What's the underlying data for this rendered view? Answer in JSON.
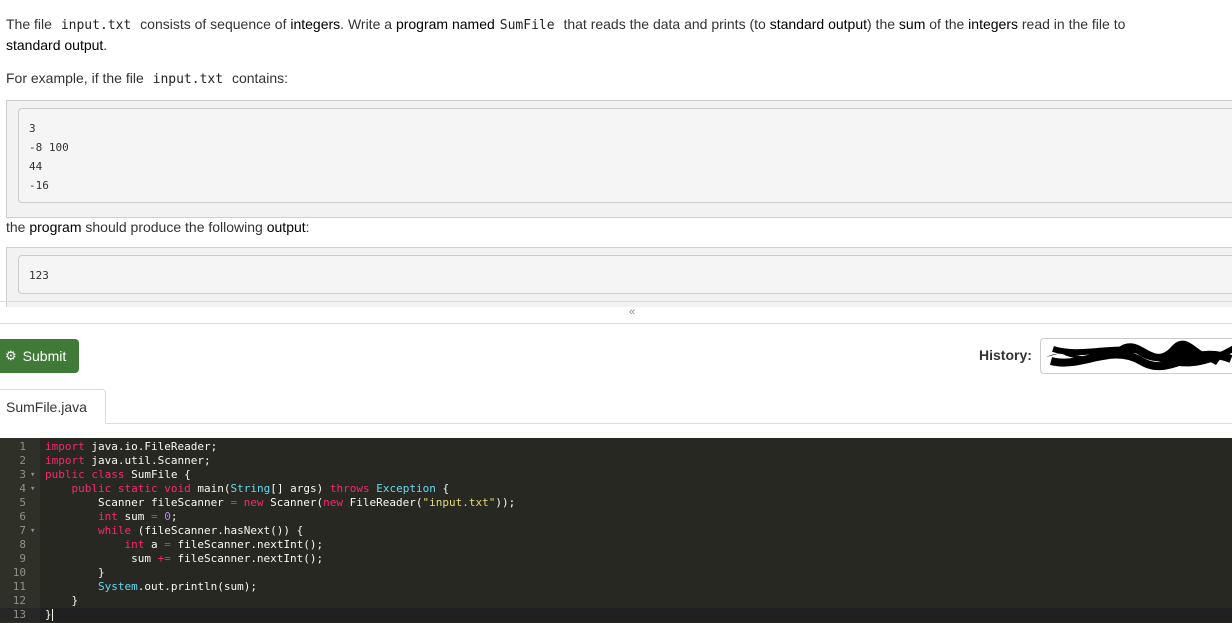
{
  "problem": {
    "p1": [
      {
        "t": "The file ",
        "code": false,
        "bold": false
      },
      {
        "t": "input.txt",
        "code": true,
        "bold": false
      },
      {
        "t": " consists of sequence of ",
        "code": false,
        "bold": false
      },
      {
        "t": "integers",
        "code": false,
        "bold": true
      },
      {
        "t": ". Write a ",
        "code": false,
        "bold": false
      },
      {
        "t": "program named",
        "code": false,
        "bold": true
      },
      {
        "t": "SumFile",
        "code": true,
        "bold": false
      },
      {
        "t": " that reads the data and prints (to ",
        "code": false,
        "bold": false
      },
      {
        "t": "standard output",
        "code": false,
        "bold": true
      },
      {
        "t": ") the ",
        "code": false,
        "bold": false
      },
      {
        "t": "sum",
        "code": false,
        "bold": true
      },
      {
        "t": " of the ",
        "code": false,
        "bold": false
      },
      {
        "t": "integers",
        "code": false,
        "bold": true
      },
      {
        "t": " read in the file to",
        "code": false,
        "bold": false
      }
    ],
    "p1_line2": [
      {
        "t": "standard output",
        "code": false,
        "bold": true
      },
      {
        "t": ".",
        "code": false,
        "bold": false
      }
    ],
    "p2": [
      {
        "t": "For example, if the file ",
        "code": false,
        "bold": false
      },
      {
        "t": "input.txt",
        "code": true,
        "bold": false
      },
      {
        "t": " contains:",
        "code": false,
        "bold": false
      }
    ],
    "sample_input": [
      "3",
      "-8 100",
      "44",
      "-16"
    ],
    "p3": [
      {
        "t": "the ",
        "code": false,
        "bold": false
      },
      {
        "t": "program",
        "code": false,
        "bold": true
      },
      {
        "t": " should produce the following ",
        "code": false,
        "bold": false
      },
      {
        "t": "output",
        "code": false,
        "bold": true
      },
      {
        "t": ":",
        "code": false,
        "bold": false
      }
    ],
    "sample_output": [
      "123"
    ]
  },
  "toolbar": {
    "submit_label": "Submit",
    "history_label": "History:"
  },
  "tabs": [
    {
      "label": "SumFile.java",
      "active": true
    }
  ],
  "editor": {
    "lines": [
      {
        "n": "1",
        "fold": false,
        "tokens": [
          {
            "c": "keyword",
            "t": "import"
          },
          {
            "c": "plain",
            "t": " java.io.FileReader;"
          }
        ]
      },
      {
        "n": "2",
        "fold": false,
        "tokens": [
          {
            "c": "keyword",
            "t": "import"
          },
          {
            "c": "plain",
            "t": " java.util.Scanner;"
          }
        ]
      },
      {
        "n": "3",
        "fold": true,
        "tokens": [
          {
            "c": "keyword",
            "t": "public"
          },
          {
            "c": "plain",
            "t": " "
          },
          {
            "c": "keyword",
            "t": "class"
          },
          {
            "c": "plain",
            "t": " SumFile {"
          }
        ]
      },
      {
        "n": "4",
        "fold": true,
        "tokens": [
          {
            "c": "plain",
            "t": "    "
          },
          {
            "c": "keyword",
            "t": "public"
          },
          {
            "c": "plain",
            "t": " "
          },
          {
            "c": "keyword",
            "t": "static"
          },
          {
            "c": "plain",
            "t": " "
          },
          {
            "c": "keyword",
            "t": "void"
          },
          {
            "c": "plain",
            "t": " main("
          },
          {
            "c": "type",
            "t": "String"
          },
          {
            "c": "plain",
            "t": "[] args) "
          },
          {
            "c": "keyword",
            "t": "throws"
          },
          {
            "c": "plain",
            "t": " "
          },
          {
            "c": "type",
            "t": "Exception"
          },
          {
            "c": "plain",
            "t": " {"
          }
        ]
      },
      {
        "n": "5",
        "fold": false,
        "tokens": [
          {
            "c": "plain",
            "t": "        Scanner fileScanner "
          },
          {
            "c": "keyword",
            "t": "="
          },
          {
            "c": "plain",
            "t": " "
          },
          {
            "c": "keyword",
            "t": "new"
          },
          {
            "c": "plain",
            "t": " Scanner("
          },
          {
            "c": "keyword",
            "t": "new"
          },
          {
            "c": "plain",
            "t": " FileReader("
          },
          {
            "c": "string",
            "t": "\"input.txt\""
          },
          {
            "c": "plain",
            "t": "));"
          }
        ]
      },
      {
        "n": "6",
        "fold": false,
        "tokens": [
          {
            "c": "plain",
            "t": "        "
          },
          {
            "c": "keyword",
            "t": "int"
          },
          {
            "c": "plain",
            "t": " sum "
          },
          {
            "c": "keyword",
            "t": "="
          },
          {
            "c": "plain",
            "t": " "
          },
          {
            "c": "number",
            "t": "0"
          },
          {
            "c": "plain",
            "t": ";"
          }
        ]
      },
      {
        "n": "7",
        "fold": true,
        "tokens": [
          {
            "c": "plain",
            "t": "        "
          },
          {
            "c": "keyword",
            "t": "while"
          },
          {
            "c": "plain",
            "t": " (fileScanner.hasNext()) {"
          }
        ]
      },
      {
        "n": "8",
        "fold": false,
        "tokens": [
          {
            "c": "plain",
            "t": "            "
          },
          {
            "c": "keyword",
            "t": "int"
          },
          {
            "c": "plain",
            "t": " a "
          },
          {
            "c": "keyword",
            "t": "="
          },
          {
            "c": "plain",
            "t": " fileScanner.nextInt();"
          }
        ]
      },
      {
        "n": "9",
        "fold": false,
        "tokens": [
          {
            "c": "plain",
            "t": "             sum "
          },
          {
            "c": "keyword",
            "t": "+="
          },
          {
            "c": "plain",
            "t": " fileScanner.nextInt();"
          }
        ]
      },
      {
        "n": "10",
        "fold": false,
        "tokens": [
          {
            "c": "plain",
            "t": "        }"
          }
        ]
      },
      {
        "n": "11",
        "fold": false,
        "tokens": [
          {
            "c": "plain",
            "t": "        "
          },
          {
            "c": "type",
            "t": "System"
          },
          {
            "c": "plain",
            "t": ".out.println(sum);"
          }
        ]
      },
      {
        "n": "12",
        "fold": false,
        "tokens": [
          {
            "c": "plain",
            "t": "    }"
          }
        ]
      },
      {
        "n": "13",
        "fold": false,
        "active": true,
        "tokens": [
          {
            "c": "plain",
            "t": "}"
          }
        ]
      }
    ]
  },
  "colors": {
    "submit_bg": "#3f7b36",
    "editor_bg": "#272822",
    "keyword": "#f92672",
    "type": "#66d9ef",
    "string": "#e6db74",
    "number": "#ae81ff"
  },
  "icons": {
    "submit": "gear-icon",
    "expand": "chevron-double-down-icon"
  }
}
